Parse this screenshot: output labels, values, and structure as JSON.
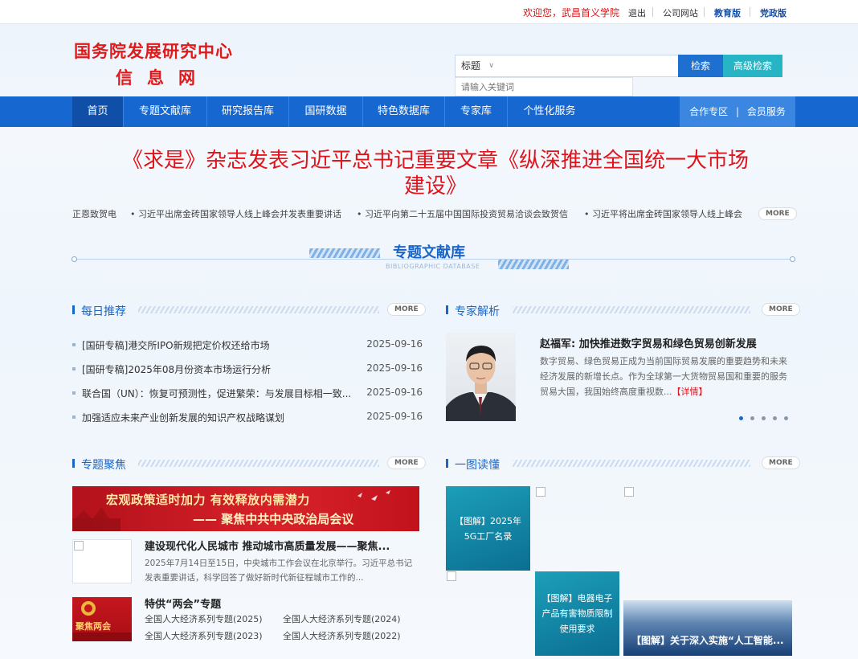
{
  "topbar": {
    "welcome": "欢迎您，武昌首义学院",
    "logout": "退出",
    "company_site": "公司网站",
    "edu_edition": "教育版",
    "party_edition": "党政版"
  },
  "logo": {
    "line1": "国务院发展研究中心",
    "line2": "信息网"
  },
  "search": {
    "type_selected": "标题",
    "placeholder": "请输入关键词",
    "search_button": "检索",
    "advanced_button": "高级检索"
  },
  "nav": {
    "items": [
      "首页",
      "专题文献库",
      "研究报告库",
      "国研数据",
      "特色数据库",
      "专家库",
      "个性化服务"
    ],
    "right_1": "合作专区",
    "right_sep": "|",
    "right_2": "会员服务"
  },
  "headline": {
    "line1": "《求是》杂志发表习近平总书记重要文章《纵深推进全国统一大市场",
    "line2": "建设》"
  },
  "ticker": {
    "items": [
      "正恩致贺电",
      "• 习近平出席金砖国家领导人线上峰会并发表重要讲话",
      "• 习近平向第二十五届中国国际投资贸易洽谈会致贺信",
      "• 习近平将出席金砖国家领导人线上峰会"
    ],
    "more": "MORE"
  },
  "section": {
    "title_cn": "专题文献库",
    "title_en": "BIBLIOGRAPHIC DATABASE"
  },
  "daily": {
    "title": "每日推荐",
    "more": "MORE",
    "items": [
      {
        "text": "[国研专稿]港交所IPO新规把定价权还给市场",
        "date": "2025-09-16"
      },
      {
        "text": "[国研专稿]2025年08月份资本市场运行分析",
        "date": "2025-09-16"
      },
      {
        "text": "联合国（UN）：恢复可预测性，促进繁荣：与发展目标相一致...",
        "date": "2025-09-16"
      },
      {
        "text": "加强适应未来产业创新发展的知识产权战略谋划",
        "date": "2025-09-16"
      }
    ]
  },
  "expert": {
    "title": "专家解析",
    "more": "MORE",
    "name": "赵福军: 加快推进数字贸易和绿色贸易创新发展",
    "desc": "数字贸易、绿色贸易正成为当前国际贸易发展的重要趋势和未来经济发展的新增长点。作为全球第一大货物贸易国和重要的服务贸易大国，我国始终高度重视数...",
    "detail": "【详情】",
    "slide_count": 5,
    "slide_active": 1
  },
  "focus": {
    "title": "专题聚焦",
    "more": "MORE",
    "banner_line1": "宏观政策适时加力 有效释放内需潜力",
    "banner_line2": "—— 聚焦中共中央政治局会议",
    "article_title": "建设现代化人民城市 推动城市高质量发展——聚焦...",
    "article_desc": "2025年7月14日至15日，中央城市工作会议在北京举行。习近平总书记发表重要讲话，科学回答了做好新时代新征程城市工作的...",
    "special_img_text": "聚焦两会",
    "special_title": "特供“两会”专题",
    "links": [
      "全国人大经济系列专题(2025)",
      "全国人大经济系列专题(2024)",
      "全国人大经济系列专题(2023)",
      "全国人大经济系列专题(2022)"
    ]
  },
  "picread": {
    "title": "一图读懂",
    "more": "MORE",
    "tile1": "【图解】2025年5G工厂名录",
    "tile2": "【图解】电器电子产品有害物质限制使用要求",
    "tile3": "【图解】关于深入实施“人工智能..."
  },
  "colors": {
    "primary": "#1767d0",
    "accent_red": "#e0141b",
    "teal": "#27b4c4"
  }
}
